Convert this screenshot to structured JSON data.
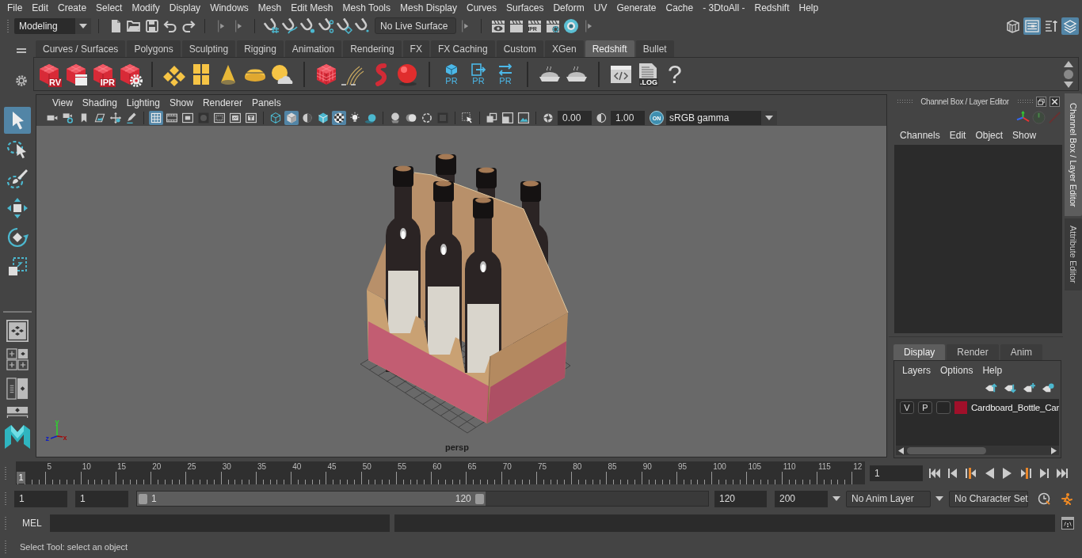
{
  "menu_bar": {
    "items": [
      "File",
      "Edit",
      "Create",
      "Select",
      "Modify",
      "Display",
      "Windows",
      "Mesh",
      "Edit Mesh",
      "Mesh Tools",
      "Mesh Display",
      "Curves",
      "Surfaces",
      "Deform",
      "UV",
      "Generate",
      "Cache",
      "- 3DtoAll -",
      "Redshift",
      "Help"
    ]
  },
  "status_line": {
    "mode": "Modeling",
    "groups": [
      {
        "buttons": [
          {
            "kind": "newscene"
          },
          {
            "kind": "open"
          },
          {
            "kind": "save"
          },
          {
            "kind": "undo"
          },
          {
            "kind": "redo"
          }
        ]
      },
      {
        "buttons": [
          {
            "kind": "snapgrid"
          },
          {
            "kind": "snapcurve"
          },
          {
            "kind": "snappoint"
          },
          {
            "kind": "snapplane"
          },
          {
            "kind": "snapsurface"
          },
          {
            "kind": "magnet"
          }
        ]
      }
    ],
    "live_surface": "No Live Surface",
    "render_buttons": [
      {
        "kind": "renderview"
      },
      {
        "kind": "render"
      },
      {
        "kind": "render",
        "label": "IPR"
      },
      {
        "kind": "rendersettings"
      },
      {
        "kind": "hypershade"
      }
    ],
    "panel_toggles": [
      {
        "kind": "toolkit",
        "on": false
      },
      {
        "kind": "attributes",
        "on": true
      },
      {
        "kind": "toolsettings",
        "on": false
      },
      {
        "kind": "channelbox",
        "on": true
      }
    ]
  },
  "shelf": {
    "tabs": [
      {
        "label": "Curves / Surfaces",
        "selected": false
      },
      {
        "label": "Polygons",
        "selected": false
      },
      {
        "label": "Sculpting",
        "selected": false
      },
      {
        "label": "Rigging",
        "selected": false
      },
      {
        "label": "Animation",
        "selected": false
      },
      {
        "label": "Rendering",
        "selected": false
      },
      {
        "label": "FX",
        "selected": false
      },
      {
        "label": "FX Caching",
        "selected": false
      },
      {
        "label": "Custom",
        "selected": false
      },
      {
        "label": "XGen",
        "selected": false
      },
      {
        "label": "Redshift",
        "selected": true
      },
      {
        "label": "Bullet",
        "selected": false
      }
    ],
    "groups": [
      {
        "buttons": [
          {
            "kind": "rscube",
            "label": "RV"
          },
          {
            "kind": "rsclapper"
          },
          {
            "kind": "rscube",
            "label": "IPR"
          },
          {
            "kind": "rsgear"
          }
        ]
      },
      {
        "buttons": [
          {
            "kind": "rsdiamond"
          },
          {
            "kind": "rsgrid"
          },
          {
            "kind": "rscone"
          },
          {
            "kind": "rsdome"
          },
          {
            "kind": "rssun"
          }
        ]
      },
      {
        "buttons": [
          {
            "kind": "rsvolume"
          },
          {
            "kind": "rshair"
          },
          {
            "kind": "rsworm"
          },
          {
            "kind": "rsball"
          }
        ]
      },
      {
        "buttons": [
          {
            "kind": "prcube",
            "label": "PR"
          },
          {
            "kind": "prexport",
            "label": "PR"
          },
          {
            "kind": "prswap",
            "label": "PR"
          }
        ]
      },
      {
        "buttons": [
          {
            "kind": "pie"
          },
          {
            "kind": "pie"
          }
        ]
      },
      {
        "buttons": [
          {
            "kind": "code"
          },
          {
            "kind": "log",
            "label": ".LOG"
          },
          {
            "kind": "help",
            "label": "?"
          }
        ]
      }
    ]
  },
  "toolbox": {
    "tools": [
      {
        "kind": "select",
        "selected": true
      },
      {
        "kind": "lasso",
        "selected": false
      },
      {
        "kind": "paint",
        "selected": false
      },
      {
        "kind": "move",
        "selected": false
      },
      {
        "kind": "rotate",
        "selected": false
      },
      {
        "kind": "scale",
        "selected": false
      }
    ]
  },
  "viewport": {
    "menu": [
      "View",
      "Shading",
      "Lighting",
      "Show",
      "Renderer",
      "Panels"
    ],
    "toolbar": [
      {
        "buttons": [
          {
            "kind": "camera",
            "on": false
          },
          {
            "kind": "camattr",
            "on": false
          },
          {
            "kind": "bookmark",
            "on": false
          },
          {
            "kind": "imageplane",
            "on": false
          },
          {
            "kind": "pan",
            "on": false
          },
          {
            "kind": "pencil",
            "on": false
          }
        ]
      },
      {
        "buttons": [
          {
            "kind": "grid",
            "on": true
          },
          {
            "kind": "filmgate",
            "on": false
          },
          {
            "kind": "resgate",
            "on": false
          },
          {
            "kind": "gatemask",
            "on": false
          },
          {
            "kind": "fieldchart",
            "on": false
          },
          {
            "kind": "safeaction",
            "on": false
          },
          {
            "kind": "safetitle",
            "on": false
          }
        ]
      },
      {
        "buttons": [
          {
            "kind": "wire",
            "on": false
          },
          {
            "kind": "shaded",
            "on": true
          },
          {
            "kind": "material",
            "on": false
          },
          {
            "kind": "wireshaded",
            "on": false
          },
          {
            "kind": "xray",
            "on": true
          },
          {
            "kind": "lights",
            "on": false
          },
          {
            "kind": "shadows",
            "on": false
          }
        ]
      },
      {
        "buttons": [
          {
            "kind": "ambient",
            "on": false
          },
          {
            "kind": "motionblur",
            "on": false
          },
          {
            "kind": "antialias",
            "on": false
          },
          {
            "kind": "dof",
            "on": false
          }
        ]
      },
      {
        "buttons": [
          {
            "kind": "isolate",
            "on": false
          }
        ]
      },
      {
        "buttons": [
          {
            "kind": "xrayjoints",
            "on": false
          },
          {
            "kind": "xraycomp",
            "on": false
          },
          {
            "kind": "hud",
            "on": false
          }
        ]
      }
    ],
    "exposure": "0.00",
    "gamma": "1.00",
    "color_management": {
      "label": "ON",
      "on": true
    },
    "view_transform": "sRGB gamma",
    "camera": "persp",
    "axis_labels": [
      "y",
      "z",
      "x"
    ]
  },
  "channel_box": {
    "title": "Channel Box / Layer Editor",
    "menu": [
      "Channels",
      "Edit",
      "Object",
      "Show"
    ],
    "layer_tabs": [
      {
        "label": "Display",
        "selected": true
      },
      {
        "label": "Render",
        "selected": false
      },
      {
        "label": "Anim",
        "selected": false
      }
    ],
    "layer_menu": [
      "Layers",
      "Options",
      "Help"
    ],
    "layers": [
      {
        "visibility": "V",
        "playback": "P",
        "color": "#a0102a",
        "name": "Cardboard_Bottle_Car"
      }
    ]
  },
  "side_tabs": [
    {
      "label": "Channel Box / Layer Editor",
      "selected": true
    },
    {
      "label": "Attribute Editor",
      "selected": false
    }
  ],
  "time_slider": {
    "marker": "1",
    "level": 0,
    "frame_labels": [
      "5",
      "10",
      "15",
      "20",
      "25",
      "30",
      "35",
      "40",
      "45",
      "50",
      "55",
      "60",
      "65",
      "70",
      "75",
      "80",
      "85",
      "90",
      "95",
      "100",
      "105",
      "110",
      "115",
      "12"
    ],
    "current_frame": "1"
  },
  "range_slider": {
    "anim_start": "1",
    "play_start": "1",
    "range_start": "1",
    "range_end": "120",
    "level": 0.61,
    "play_end": "120",
    "anim_end": "200",
    "anim_layer": "No Anim Layer",
    "character_set": "No Character Set"
  },
  "command_line": {
    "language": "MEL"
  },
  "help_line": "Select Tool: select an object"
}
